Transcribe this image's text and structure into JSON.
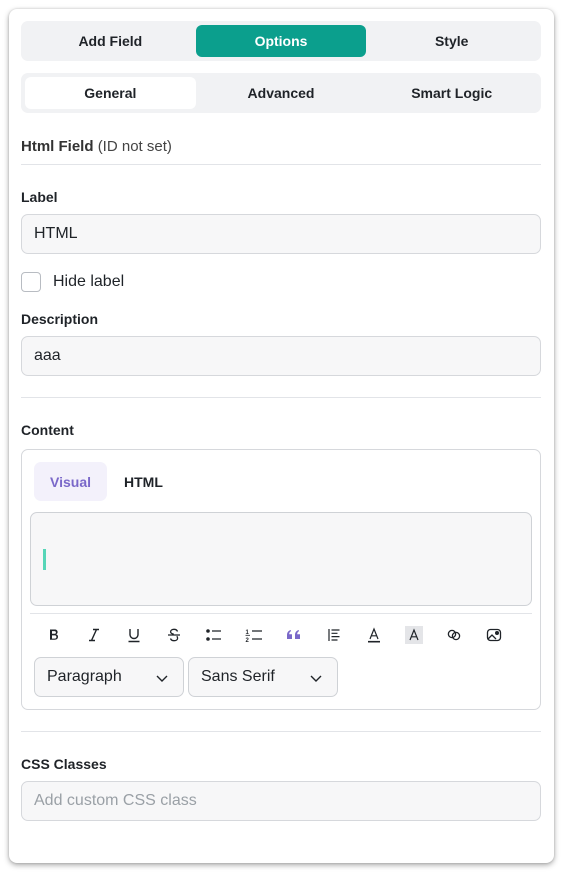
{
  "top_tabs": [
    {
      "label": "Add Field",
      "active": false
    },
    {
      "label": "Options",
      "active": true
    },
    {
      "label": "Style",
      "active": false
    }
  ],
  "sub_tabs": [
    {
      "label": "General",
      "active": true
    },
    {
      "label": "Advanced",
      "active": false
    },
    {
      "label": "Smart Logic",
      "active": false
    }
  ],
  "field_header": {
    "name": "Html Field",
    "id_note": "(ID not set)"
  },
  "label_section": {
    "label": "Label",
    "value": "HTML"
  },
  "hide_label": {
    "label": "Hide label",
    "checked": false
  },
  "description_section": {
    "label": "Description",
    "value": "aaa"
  },
  "content_section": {
    "label": "Content",
    "editor_tabs": [
      {
        "label": "Visual",
        "active": true
      },
      {
        "label": "HTML",
        "active": false
      }
    ],
    "toolbar_icons": [
      "bold-icon",
      "italic-icon",
      "underline-icon",
      "strikethrough-icon",
      "bullet-list-icon",
      "numbered-list-icon",
      "blockquote-icon",
      "align-icon",
      "text-color-icon",
      "background-color-icon",
      "link-icon",
      "media-icon"
    ],
    "format_select": "Paragraph",
    "font_select": "Sans Serif"
  },
  "css_section": {
    "label": "CSS Classes",
    "placeholder": "Add custom CSS class"
  },
  "colors": {
    "accent": "#0b9f8d",
    "visual_tab": "#7a68c9",
    "caret": "#57d6b8"
  }
}
